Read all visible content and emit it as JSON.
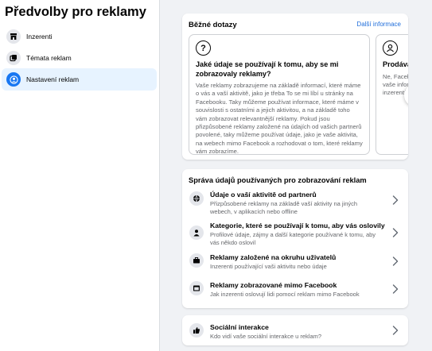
{
  "sidebar": {
    "title": "Předvolby pro reklamy",
    "items": [
      {
        "label": "Inzerenti",
        "icon": "storefront-icon"
      },
      {
        "label": "Témata reklam",
        "icon": "topics-icon"
      },
      {
        "label": "Nastavení reklam",
        "icon": "account-settings-icon",
        "active": true
      }
    ]
  },
  "faq": {
    "title": "Běžné dotazy",
    "more_link": "Další informace",
    "items": [
      {
        "icon": "question-icon",
        "question": "Jaké údaje se používají k tomu, aby se mi zobrazovaly reklamy?",
        "answer": "Vaše reklamy zobrazujeme na základě informací, které máme o vás a vaší aktivitě, jako je třeba To se mi líbí u stránky na Facebooku. Taky můžeme používat informace, které máme v souvislosti s ostatními a jejich aktivitou, a na základě toho vám zobrazovat relevantnější reklamy. Pokud jsou přizpůsobené reklamy založené na údajích od vašich partnerů povolené, taky můžeme používat údaje, jako je vaše aktivita, na webech mimo Facebook a rozhodovat o tom, které reklamy vám zobrazíme."
      },
      {
        "icon": "person-icon",
        "question": "Prodává",
        "answer": "Ne, Facebo\nvaše inform\ninzerentům"
      }
    ]
  },
  "data_section": {
    "title": "Správa údajů používaných pro zobrazování reklam",
    "rows": [
      {
        "title": "Údaje o vaší aktivitě od partnerů",
        "desc": "Přizpůsobené reklamy na základě vaší aktivity na jiných webech, v aplikacích nebo offline",
        "icon": "globe-icon"
      },
      {
        "title": "Kategorie, které se používají k tomu, aby vás oslovily",
        "desc": "Profilové údaje, zájmy a další kategorie používané k tomu, aby vás někdo oslovil",
        "icon": "person-icon"
      },
      {
        "title": "Reklamy založené na okruhu uživatelů",
        "desc": "Inzerenti používající vaši aktivitu nebo údaje",
        "icon": "briefcase-icon"
      },
      {
        "title": "Reklamy zobrazované mimo Facebook",
        "desc": "Jak inzerenti oslovují lidi pomocí reklam mimo Facebook",
        "icon": "window-icon"
      }
    ]
  },
  "social": {
    "title": "Sociální interakce",
    "desc": "Kdo vidí vaše sociální interakce u reklam?",
    "icon": "thumbs-up-icon"
  },
  "colors": {
    "accent": "#1877f2",
    "link": "#216fdb",
    "active_bg": "#e7f3ff",
    "page_bg": "#f0f2f5"
  }
}
